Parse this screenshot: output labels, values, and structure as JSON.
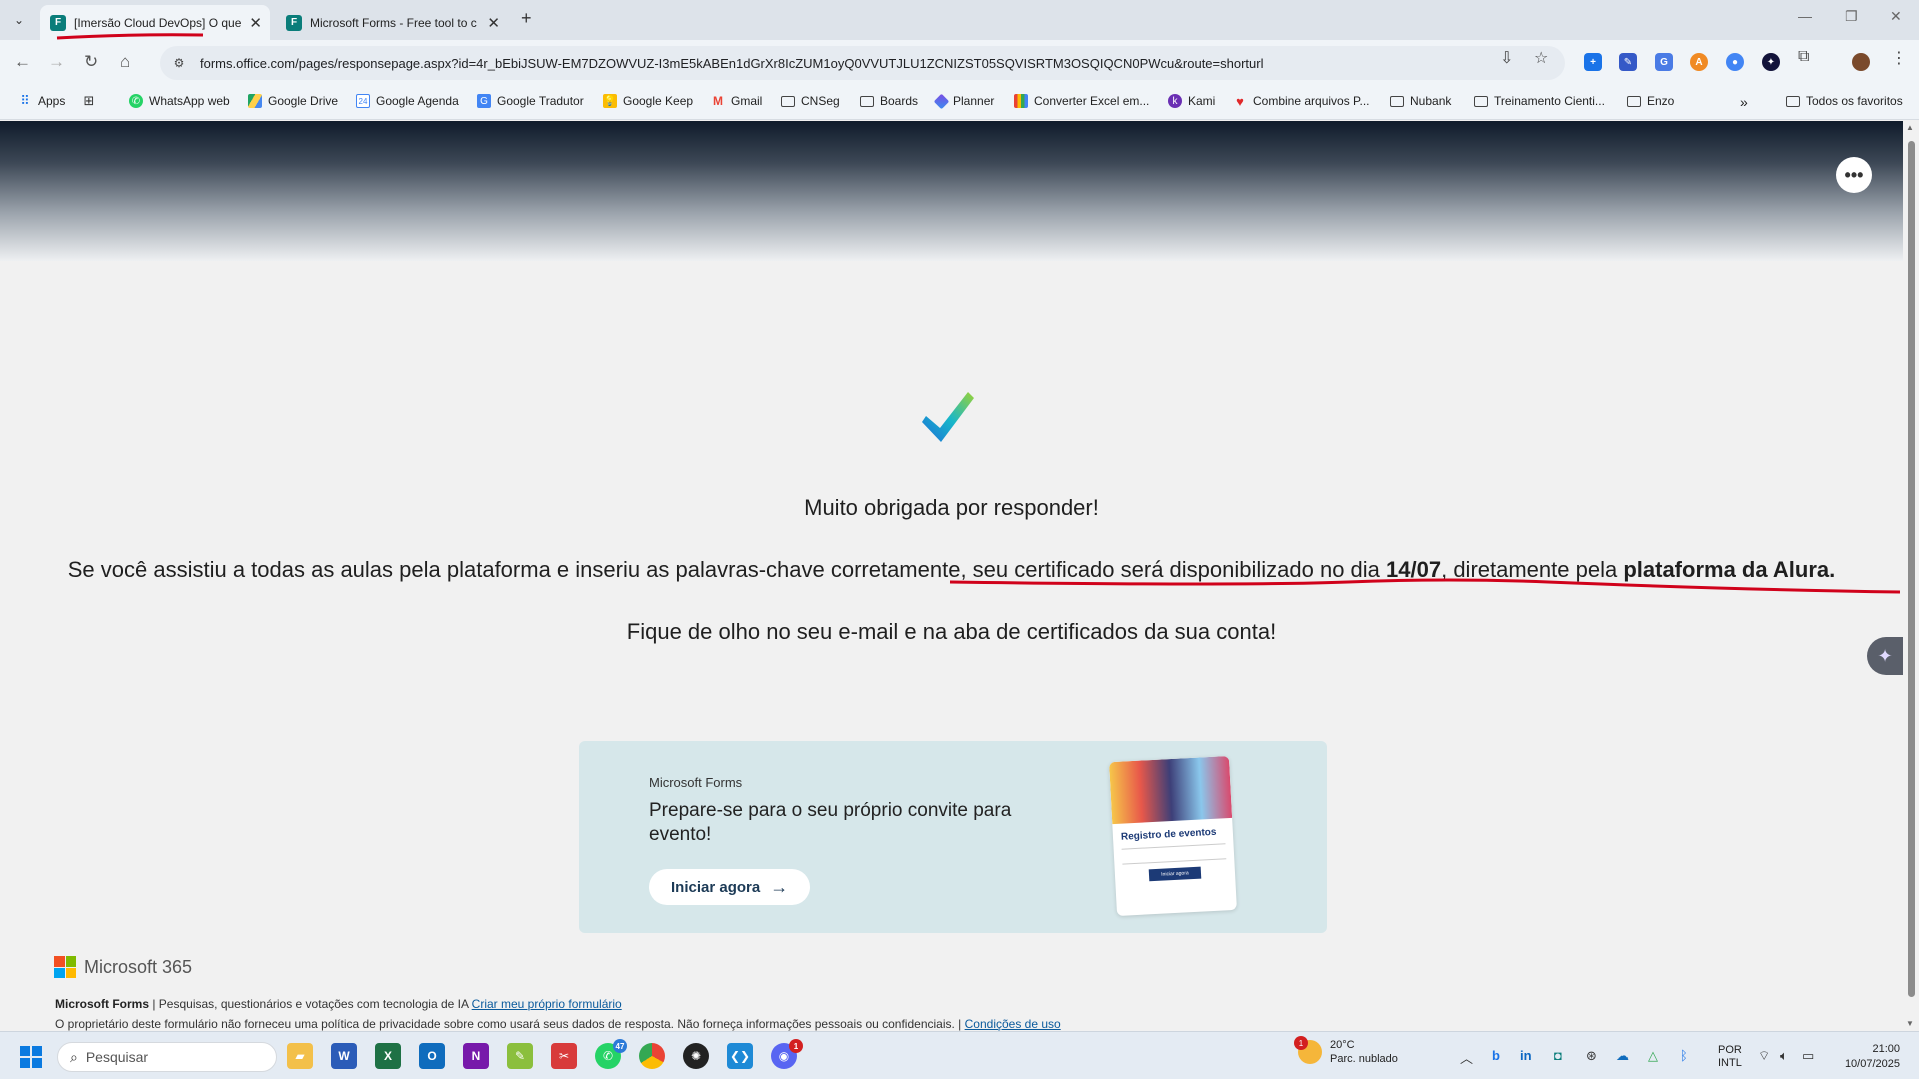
{
  "browser": {
    "tabs": [
      {
        "title": "[Imersão Cloud DevOps] O que",
        "favicon": "F"
      },
      {
        "title": "Microsoft Forms - Free tool to c",
        "favicon": "F"
      }
    ],
    "new_tab": "+",
    "url": "forms.office.com/pages/responsepage.aspx?id=4r_bEbiJSUW-EM7DZOWVUZ-I3mE5kABEn1dGrXr8IcZUM1oyQ0VVUTJLU1ZCNIZST05SQVISRTM3OSQIQCN0PWcu&route=shorturl",
    "bookmarks": [
      {
        "label": "Apps",
        "icon": "apps-grid-icon"
      },
      {
        "label": "WhatsApp web",
        "icon": "whatsapp-icon"
      },
      {
        "label": "Google Drive",
        "icon": "google-drive-icon"
      },
      {
        "label": "Google Agenda",
        "icon": "google-calendar-icon"
      },
      {
        "label": "Google Tradutor",
        "icon": "google-translate-icon"
      },
      {
        "label": "Google Keep",
        "icon": "google-keep-icon"
      },
      {
        "label": "Gmail",
        "icon": "gmail-icon"
      },
      {
        "label": "CNSeg",
        "icon": "folder-icon"
      },
      {
        "label": "Boards",
        "icon": "folder-icon"
      },
      {
        "label": "Planner",
        "icon": "planner-icon"
      },
      {
        "label": "Converter Excel em...",
        "icon": "converter-icon"
      },
      {
        "label": "Kami",
        "icon": "kami-icon"
      },
      {
        "label": "Combine arquivos P...",
        "icon": "pdf-icon"
      },
      {
        "label": "Nubank",
        "icon": "folder-icon"
      },
      {
        "label": "Treinamento Cienti...",
        "icon": "folder-icon"
      },
      {
        "label": "Enzo",
        "icon": "folder-icon"
      }
    ],
    "more_bookmarks": "»",
    "all_bookmarks": "Todos os favoritos"
  },
  "form": {
    "title": "Muito obrigada por responder!",
    "body_part1": "Se você assistiu a todas as aulas pela plataforma e inseriu as palavras-chave corretamente, seu certificado será disponibilizado no dia ",
    "body_date": "14/07",
    "body_part2": ", diretamente pela ",
    "body_platform": "plataforma da Alura.",
    "follow_up": "Fique de olho no seu e-mail e na aba de certificados da sua conta!",
    "more_options": "•••"
  },
  "promo": {
    "brand": "Microsoft Forms",
    "headline": "Prepare-se para o seu próprio convite para evento!",
    "cta": "Iniciar agora",
    "thumbnail_title": "Registro de eventos",
    "thumbnail_button": "Iniciar agora"
  },
  "footer": {
    "logo_text": "Microsoft 365",
    "product": "Microsoft Forms",
    "tagline": " | Pesquisas, questionários e votações com tecnologia de IA ",
    "create_link": "Criar meu próprio formulário",
    "privacy": "O proprietário deste formulário não forneceu uma política de privacidade sobre como usará seus dados de resposta. Não forneça informações pessoais ou confidenciais. | ",
    "terms_link": "Condições de uso"
  },
  "taskbar": {
    "search_placeholder": "Pesquisar",
    "whatsapp_badge": "47",
    "discord_badge": "1",
    "weather_badge": "1",
    "temperature": "20°C",
    "weather_desc": "Parc. nublado",
    "lang1": "POR",
    "lang2": "INTL",
    "time": "21:00",
    "date": "10/07/2025"
  },
  "colors": {
    "annotation": "#d0021b",
    "forms_teal": "#0a7d7a",
    "promo_bg": "#d6e7ea"
  }
}
